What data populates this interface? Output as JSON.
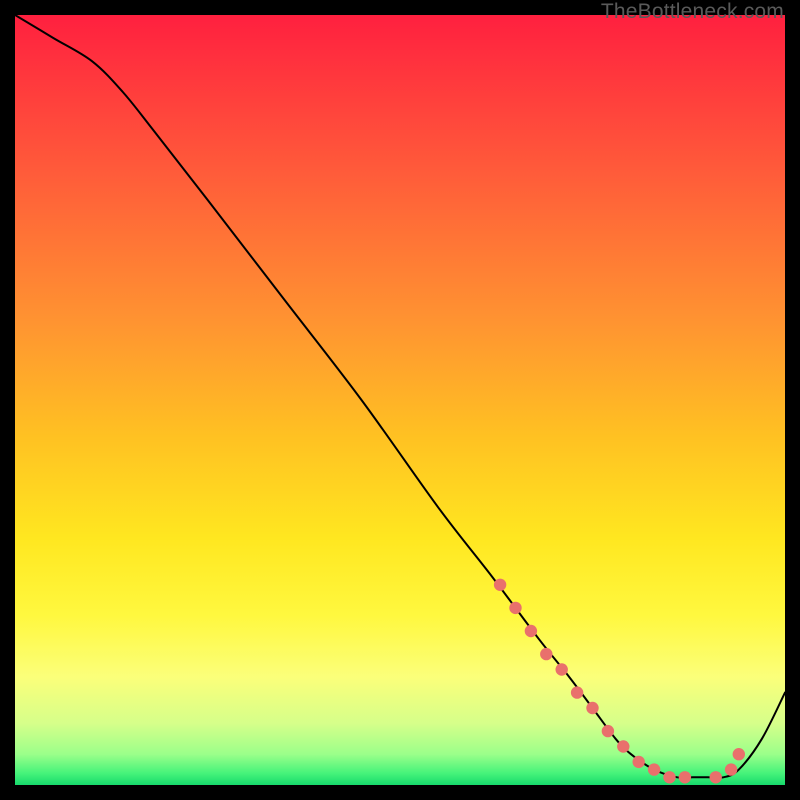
{
  "watermark": "TheBottleneck.com",
  "colors": {
    "background": "#000000",
    "curve": "#000000",
    "marker_fill": "#e9706c",
    "marker_stroke": "#d85a56",
    "gradient_stops": [
      {
        "offset": 0.0,
        "color": "#ff203f"
      },
      {
        "offset": 0.2,
        "color": "#ff5a3a"
      },
      {
        "offset": 0.4,
        "color": "#ff9431"
      },
      {
        "offset": 0.55,
        "color": "#ffc222"
      },
      {
        "offset": 0.68,
        "color": "#ffe720"
      },
      {
        "offset": 0.78,
        "color": "#fff83f"
      },
      {
        "offset": 0.86,
        "color": "#fbff7a"
      },
      {
        "offset": 0.92,
        "color": "#d6ff8a"
      },
      {
        "offset": 0.96,
        "color": "#9bff8a"
      },
      {
        "offset": 0.985,
        "color": "#45f37a"
      },
      {
        "offset": 1.0,
        "color": "#17d96c"
      }
    ]
  },
  "chart_data": {
    "type": "line",
    "title": "",
    "xlabel": "",
    "ylabel": "",
    "xlim": [
      0,
      100
    ],
    "ylim": [
      0,
      100
    ],
    "grid": false,
    "legend": false,
    "series": [
      {
        "name": "bottleneck-curve",
        "x": [
          0,
          5,
          10,
          14,
          18,
          25,
          35,
          45,
          55,
          62,
          68,
          72,
          75,
          78,
          80,
          83,
          86,
          88,
          90,
          92,
          94,
          97,
          100
        ],
        "y": [
          100,
          97,
          94,
          90,
          85,
          76,
          63,
          50,
          36,
          27,
          19,
          14,
          10,
          6,
          4,
          2,
          1,
          1,
          1,
          1,
          2,
          6,
          12
        ]
      }
    ],
    "markers": {
      "name": "highlight-points",
      "x": [
        63,
        65,
        67,
        69,
        71,
        73,
        75,
        77,
        79,
        81,
        83,
        85,
        87,
        91,
        93,
        94
      ],
      "y": [
        26,
        23,
        20,
        17,
        15,
        12,
        10,
        7,
        5,
        3,
        2,
        1,
        1,
        1,
        2,
        4
      ]
    }
  }
}
